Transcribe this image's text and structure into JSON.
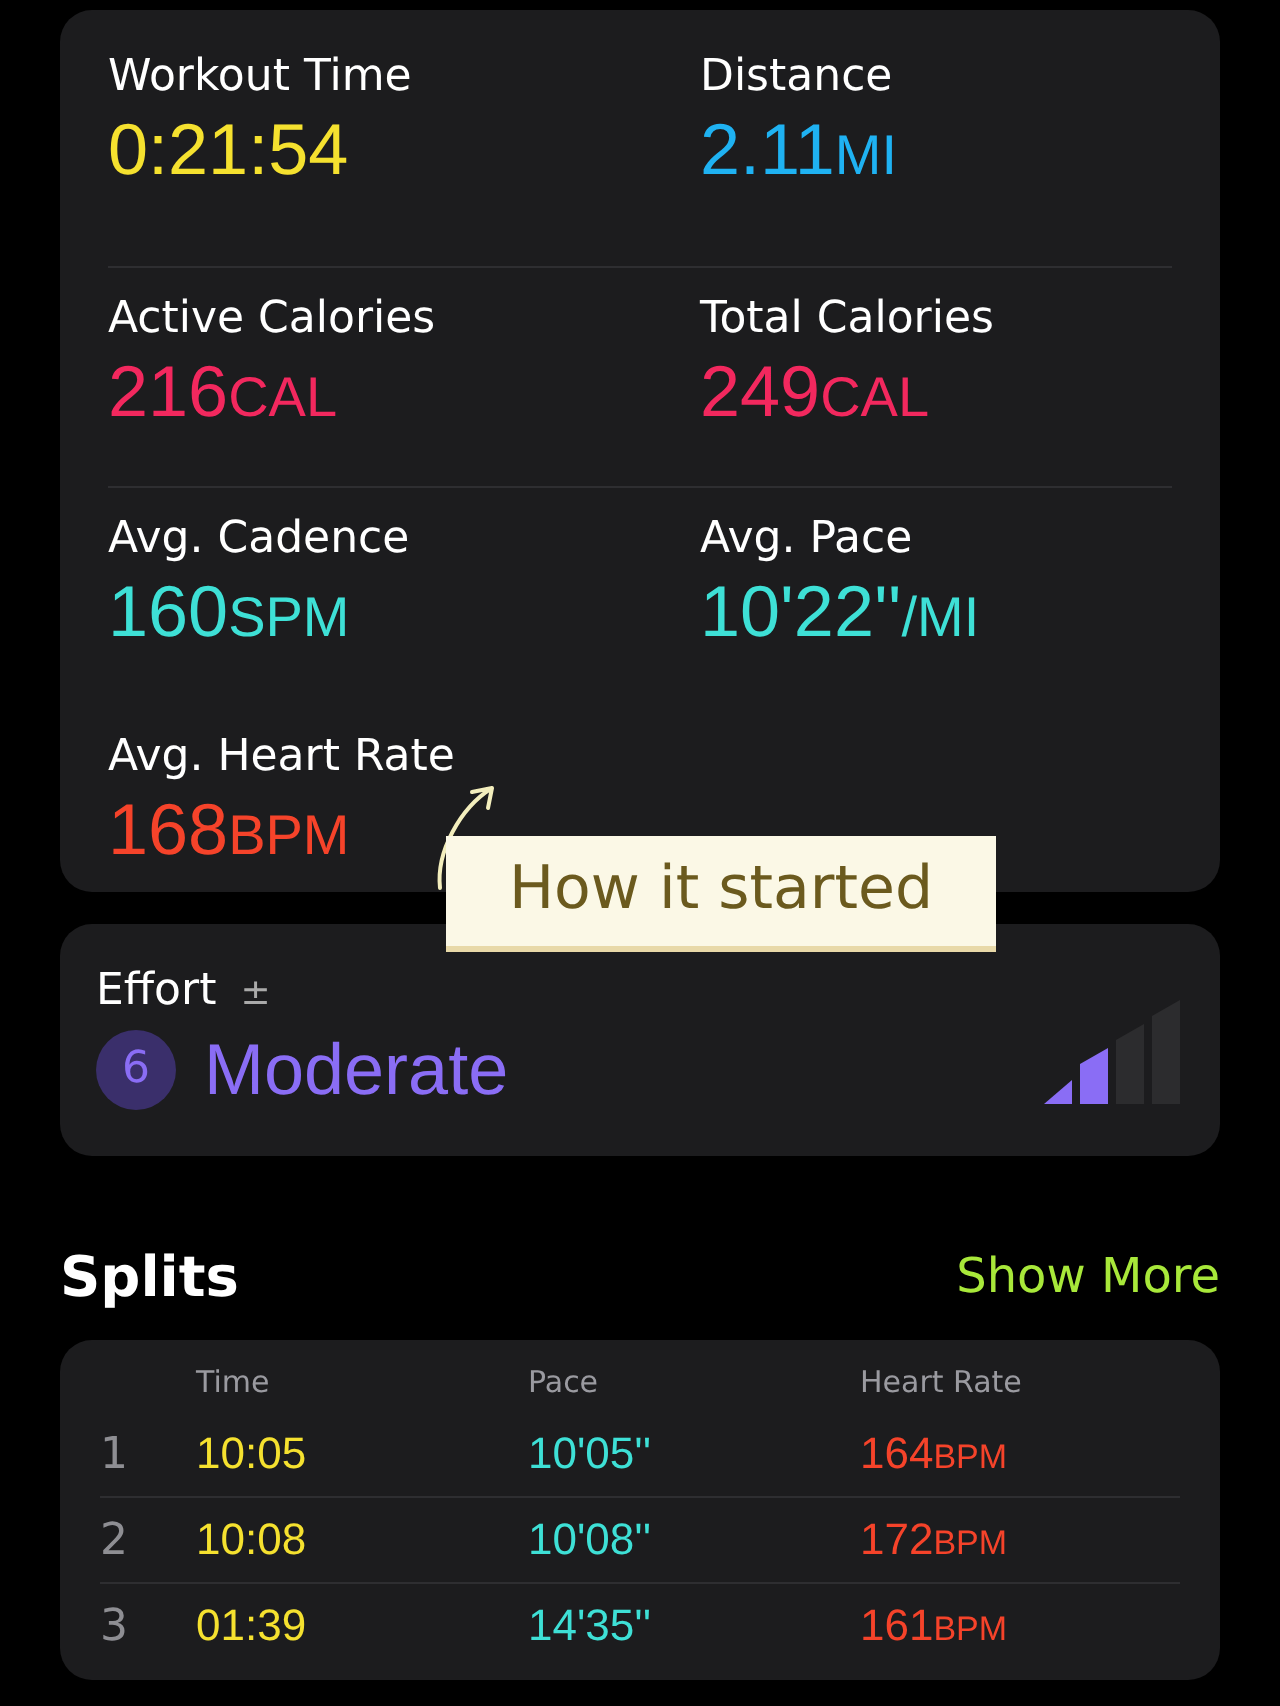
{
  "metrics": [
    {
      "label": "Workout Time",
      "value": "0:21:54",
      "color": "#f5e12f"
    },
    {
      "label": "Distance",
      "value": "2.11",
      "unit": "MI",
      "color": "#1fb2f2"
    },
    {
      "label": "Active Calories",
      "value": "216",
      "unit": "CAL",
      "color": "#f2285e"
    },
    {
      "label": "Total Calories",
      "value": "249",
      "unit": "CAL",
      "color": "#f2285e"
    },
    {
      "label": "Avg. Cadence",
      "value": "160",
      "unit": "SPM",
      "color": "#3ee0d6"
    },
    {
      "label": "Avg. Pace",
      "value": "10'22''",
      "unit": "/MI",
      "color": "#3ee0d6"
    },
    {
      "label": "Avg. Heart Rate",
      "value": "168",
      "unit": "BPM",
      "color": "#f5432a"
    }
  ],
  "note": {
    "text": "How it started"
  },
  "effort": {
    "title": "Effort",
    "adjust": "±",
    "score": "6",
    "label": "Moderate",
    "level": 0.5
  },
  "splits": {
    "title": "Splits",
    "action": "Show More",
    "columns": [
      "Time",
      "Pace",
      "Heart Rate"
    ],
    "rows": [
      {
        "index": "1",
        "time": "10:05",
        "pace": "10'05''",
        "hr": "164",
        "unit": "BPM"
      },
      {
        "index": "2",
        "time": "10:08",
        "pace": "10'08''",
        "hr": "172",
        "unit": "BPM"
      },
      {
        "index": "3",
        "time": "01:39",
        "pace": "14'35''",
        "hr": "161",
        "unit": "BPM"
      }
    ]
  }
}
